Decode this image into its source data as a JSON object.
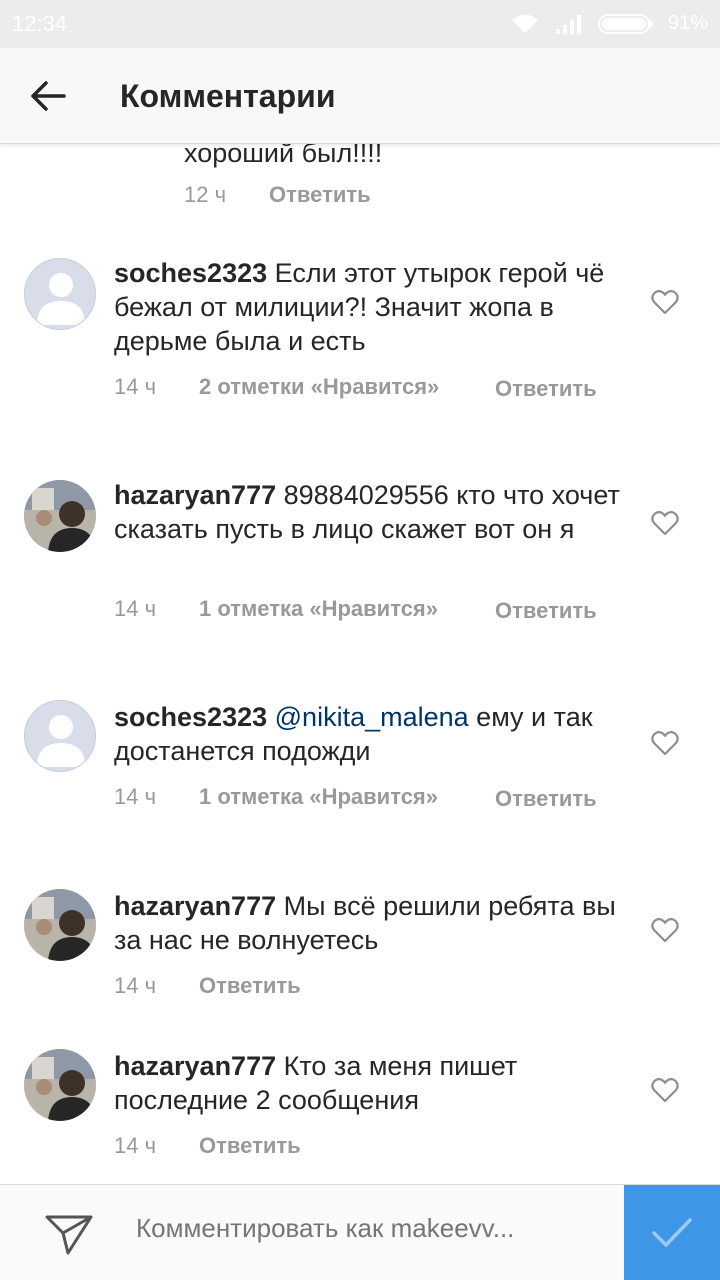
{
  "status_bar": {
    "time": "12:34",
    "battery": "91%"
  },
  "header": {
    "title": "Комментарии"
  },
  "first_comment_tail": {
    "text": "хороший был!!!!",
    "time": "12 ч",
    "reply": "Ответить"
  },
  "comments": [
    {
      "user": "soches2323",
      "text": "Если этот утырок герой чё бежал от милиции?! Значит жопа в дерьме была и есть",
      "time": "14 ч",
      "likes": "2 отметки «Нравится»",
      "reply": "Ответить",
      "avatar": "default-avatar-icon"
    },
    {
      "user": "hazaryan777",
      "text": "89884029556 кто что хочет сказать пусть в лицо скажет вот он я",
      "time": "14 ч",
      "likes": "1 отметка «Нравится»",
      "reply": "Ответить",
      "avatar": "photo"
    },
    {
      "user": "soches2323",
      "mention": "@nikita_malena",
      "text": "ему и так достанется подожди",
      "time": "14 ч",
      "likes": "1 отметка «Нравится»",
      "reply": "Ответить",
      "avatar": "default-avatar-icon"
    },
    {
      "user": "hazaryan777",
      "text": "Мы всё решили ребята вы за нас не волнуетесь",
      "time": "14 ч",
      "reply": "Ответить",
      "avatar": "photo"
    },
    {
      "user": "hazaryan777",
      "text": "Кто  за меня пишет последние 2 сообщения",
      "time": "14 ч",
      "reply": "Ответить",
      "avatar": "photo"
    }
  ],
  "composer": {
    "placeholder": "Комментировать как makeevv..."
  },
  "colors": {
    "accent": "#3e97e6",
    "meta": "#999999",
    "mention": "#003569"
  }
}
